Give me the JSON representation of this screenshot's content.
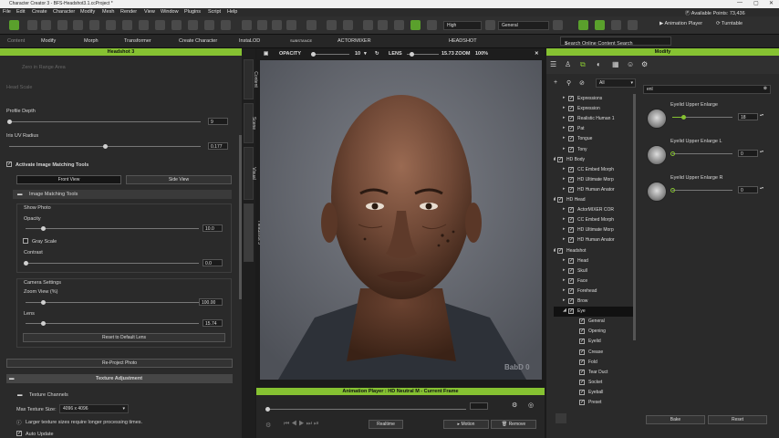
{
  "window": {
    "title": "Character Creator 3 - BFS-Headshot3.1.ccProject *",
    "available_points": "Available Points: 73,436"
  },
  "menu": [
    "File",
    "Edit",
    "Create",
    "Character",
    "Modify",
    "Mesh",
    "Render",
    "View",
    "Window",
    "Plugins",
    "Script",
    "Help"
  ],
  "toolbar1": {
    "quality": "High",
    "render_mode": "General",
    "animation_player": "Animation Player",
    "turntable": "Turntable"
  },
  "toolbar2": {
    "content": "Content",
    "modify": "Modify",
    "morph": "Morph",
    "transformer": "Transformer",
    "create_character": "Create Character",
    "instalod": "InstaLOD",
    "substance": "SUBSTANCE",
    "actormixer": "ACTORMIXER",
    "headshot": "HEADSHOT",
    "search_placeholder": "Search Online Content Search"
  },
  "left_panel": {
    "header": "Headshot 3",
    "zero_in_range": "Zero in Range Area",
    "head_scale": "Head Scale",
    "profile_depth": "Profile Depth",
    "profile_depth_value": "9",
    "iris_uv_radius": "Iris UV Radius",
    "iris_uv_radius_value": "0.177",
    "activate_image_matching": "Activate Image Matching Tools",
    "front_view": "Front View",
    "side_view": "Side View",
    "image_matching_tools": "Image Matching Tools",
    "show_photo": "Show Photo",
    "opacity": "Opacity",
    "opacity_value": "10.0",
    "gray_scale": "Gray Scale",
    "contrast": "Contrast",
    "contrast_value": "0.0",
    "camera_settings": "Camera Settings",
    "zoom_view": "Zoom View (%)",
    "zoom_view_value": "100.00",
    "lens": "Lens",
    "lens_value": "15.74",
    "reset_default_lens": "Reset to Default Lens",
    "reproject_photo": "Re-Project Photo",
    "texture_adjustment": "Texture Adjustment",
    "texture_channels": "Texture Channels",
    "max_texture_size_label": "Max Texture Size:",
    "max_texture_size": "4096 x 4096",
    "texture_note": "Larger texture sizes require longer processing times.",
    "auto_update": "Auto Update",
    "opacity_level": 0.1,
    "contrast_level": 0.0,
    "zoom_level": 0.1,
    "lens_level": 0.1,
    "profile_depth_level": 0.0,
    "iris_level": 0.5
  },
  "side_tabs": [
    "Content",
    "Scene",
    "Visual",
    "Headshot 3"
  ],
  "viewport": {
    "opacity_label": "OPACITY",
    "opacity_value": "10",
    "lens_label": "LENS",
    "lens_value": "15.73",
    "zoom_label": "ZOOM",
    "zoom_value": "100%",
    "watermark": "BabD 0"
  },
  "anim": {
    "header": "Animation Player : HD Neutral M - Current Frame",
    "realtime": "Realtime",
    "motion": "Motion",
    "remove": "Remove"
  },
  "right_panel": {
    "header": "Modify",
    "filter": "All",
    "search_value": "enl",
    "tree": [
      {
        "label": "Expressions",
        "indent": 1
      },
      {
        "label": "Expression",
        "indent": 1
      },
      {
        "label": "Realistic Human 1",
        "indent": 1
      },
      {
        "label": "Pat",
        "indent": 1
      },
      {
        "label": "Tongue",
        "indent": 1
      },
      {
        "label": "Tony",
        "indent": 1
      },
      {
        "label": "HD Body",
        "indent": 0
      },
      {
        "label": "CC Embed Morph",
        "indent": 1
      },
      {
        "label": "HD Ultimate Morp",
        "indent": 1
      },
      {
        "label": "HD Human Anator",
        "indent": 1
      },
      {
        "label": "HD Head",
        "indent": 0
      },
      {
        "label": "ActorMIXER COR",
        "indent": 1
      },
      {
        "label": "CC Embed Morph",
        "indent": 1
      },
      {
        "label": "HD Ultimate Morp",
        "indent": 1
      },
      {
        "label": "HD Human Anator",
        "indent": 1
      },
      {
        "label": "Headshot",
        "indent": 0
      },
      {
        "label": "Head",
        "indent": 1
      },
      {
        "label": "Skull",
        "indent": 1
      },
      {
        "label": "Face",
        "indent": 1
      },
      {
        "label": "Forehead",
        "indent": 1
      },
      {
        "label": "Brow",
        "indent": 1
      },
      {
        "label": "Eye",
        "indent": 1,
        "selected": true
      },
      {
        "label": "General",
        "indent": 2
      },
      {
        "label": "Opening",
        "indent": 2
      },
      {
        "label": "Eyelid",
        "indent": 2
      },
      {
        "label": "Crease",
        "indent": 2
      },
      {
        "label": "Fold",
        "indent": 2
      },
      {
        "label": "Tear Duct",
        "indent": 2
      },
      {
        "label": "Socket",
        "indent": 2
      },
      {
        "label": "Eyeball",
        "indent": 2
      },
      {
        "label": "Preset",
        "indent": 2
      }
    ],
    "morphs": [
      {
        "name": "Eyelid Upper Enlarge",
        "value": "18",
        "level": 0.18
      },
      {
        "name": "Eyelid Upper Enlarge L",
        "value": "0",
        "level": 0.0
      },
      {
        "name": "Eyelid Upper Enlarge R",
        "value": "0",
        "level": 0.0
      }
    ],
    "bake": "Bake",
    "reset": "Reset"
  },
  "colors": {
    "accent": "#86c232",
    "panel": "#2a2a2a",
    "viewport_bg": "#6b6e76"
  }
}
